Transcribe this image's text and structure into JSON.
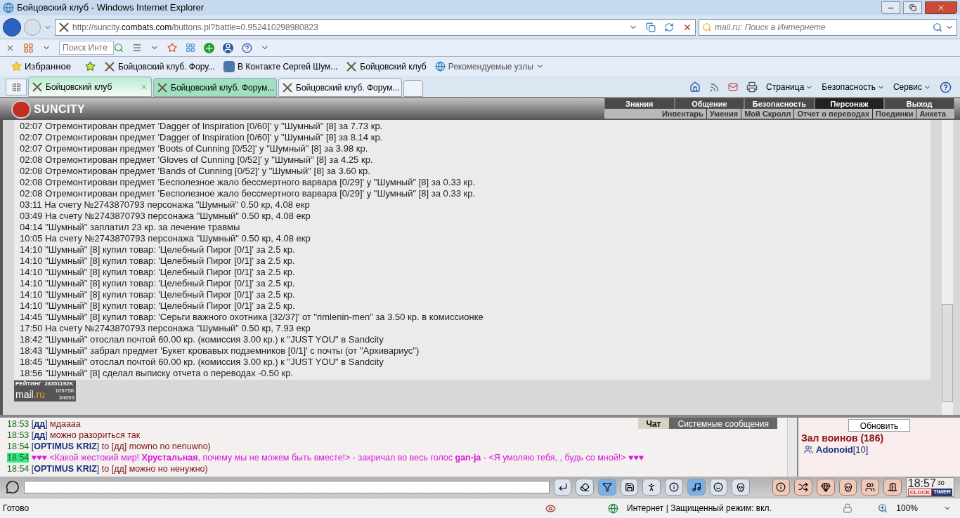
{
  "window": {
    "title": "Бойцовский клуб - Windows Internet Explorer"
  },
  "address": {
    "url_prefix": "http://suncity.",
    "url_domain": "combats.com",
    "url_rest": "/buttons.pl?battle=0.952410298980823"
  },
  "search": {
    "placeholder": "mail.ru: Поиск в Интернете"
  },
  "toolbar_search": {
    "placeholder": "Поиск Инте"
  },
  "favorites": {
    "label": "Избранное",
    "links": [
      {
        "label": "Бойцовский клуб. Фору...",
        "kind": "swords"
      },
      {
        "label": "В Контакте  Сергей Шум...",
        "kind": "vk"
      },
      {
        "label": "Бойцовский клуб",
        "kind": "swords"
      },
      {
        "label": "Рекомендуемые узлы",
        "kind": "ie"
      }
    ]
  },
  "tabs": [
    {
      "label": "Бойцовский клуб",
      "selected": true,
      "grouped": true
    },
    {
      "label": "Бойцовский клуб. Форум...",
      "selected": false,
      "grouped": true
    },
    {
      "label": "Бойцовский клуб. Форум...",
      "selected": false,
      "grouped": false
    }
  ],
  "command_bar": [
    "Страница",
    "Безопасность",
    "Сервис"
  ],
  "game": {
    "logo": "SUNCITY",
    "menu": [
      {
        "label": "Знания",
        "selected": false
      },
      {
        "label": "Общение",
        "selected": false
      },
      {
        "label": "Безопасность",
        "selected": false
      },
      {
        "label": "Персонаж",
        "selected": true
      },
      {
        "label": "Выход",
        "selected": false
      }
    ],
    "submenu": [
      "Инвентарь",
      "Умения",
      "Мой Скролл",
      "Отчет о переводах",
      "Поединки",
      "Анкета"
    ]
  },
  "log": [
    "02:07 Отремонтирован предмет 'Dagger of Inspiration [0/60]' у \"Шумный\" [8] за 7.73 кр.",
    "02:07 Отремонтирован предмет 'Dagger of Inspiration [0/60]' у \"Шумный\" [8] за 8.14 кр.",
    "02:07 Отремонтирован предмет 'Boots of Cunning [0/52]' у \"Шумный\" [8] за 3.98 кр.",
    "02:08 Отремонтирован предмет 'Gloves of Cunning [0/52]' у \"Шумный\" [8] за 4.25 кр.",
    "02:08 Отремонтирован предмет 'Bands of Cunning [0/52]' у \"Шумный\" [8] за 3.60 кр.",
    "02:08 Отремонтирован предмет 'Бесполезное жало бессмертного варвара [0/29]' у \"Шумный\" [8] за 0.33 кр.",
    "02:08 Отремонтирован предмет 'Бесполезное жало бессмертного варвара [0/29]' у \"Шумный\" [8] за 0.33 кр.",
    "03:11 На счету №2743870793 персонажа \"Шумный\" 0.50 кр, 4.08 екр",
    "03:49 На счету №2743870793 персонажа \"Шумный\" 0.50 кр, 4.08 екр",
    "04:14 \"Шумный\" заплатил 23 кр. за лечение травмы",
    "10:05 На счету №2743870793 персонажа \"Шумный\" 0.50 кр, 4.08 екр",
    "14:10 \"Шумный\" [8] купил товар: 'Целебный Пирог [0/1]' за 2.5 кр.",
    "14:10 \"Шумный\" [8] купил товар: 'Целебный Пирог [0/1]' за 2.5 кр.",
    "14:10 \"Шумный\" [8] купил товар: 'Целебный Пирог [0/1]' за 2.5 кр.",
    "14:10 \"Шумный\" [8] купил товар: 'Целебный Пирог [0/1]' за 2.5 кр.",
    "14:10 \"Шумный\" [8] купил товар: 'Целебный Пирог [0/1]' за 2.5 кр.",
    "14:10 \"Шумный\" [8] купил товар: 'Целебный Пирог [0/1]' за 2.5 кр.",
    "14:45 \"Шумный\" [8] купил товар: 'Серьги важного охотника [32/37]' от \"rimlenin-men\" за 3.50 кр. в комиссионке",
    "17:50 На счету №2743870793 персонажа \"Шумный\" 0.50 кр, 7.93 екр",
    "18:42 \"Шумный\" отослал почтой 60.00 кр. (комиссия 3.00 кр.) к \"JUST YOU\" в Sandcity",
    "18:43 \"Шумный\" забрал предмет 'Букет кровавых подземников [0/1]' с почты (от \"Архивариус\")",
    "18:45 \"Шумный\" отослал почтой 60.00 кр. (комиссия 3.00 кр.) к \"JUST YOU\" в Sandcity",
    "18:56 \"Шумный\" [8] сделал выписку отчета о переводах -0.50 кр."
  ],
  "rating_badge": {
    "title": "РЕЙТИНГ",
    "total": "28351192K",
    "brand_a": "mail",
    "brand_b": ".ru",
    "stat_1": "10975K",
    "stat_2": "34693"
  },
  "chat_tabs": [
    {
      "label": "Чат",
      "selected": true
    },
    {
      "label": "Системные сообщения",
      "selected": false
    }
  ],
  "chat": [
    {
      "time": "18:53",
      "highlight": false,
      "parts": [
        {
          "kind": "punct",
          "text": "["
        },
        {
          "kind": "nick",
          "text": "дд"
        },
        {
          "kind": "punct",
          "text": "]"
        },
        {
          "kind": "text",
          "text": " мдаааа"
        }
      ]
    },
    {
      "time": "18:53",
      "highlight": false,
      "parts": [
        {
          "kind": "punct",
          "text": "["
        },
        {
          "kind": "nick",
          "text": "дд"
        },
        {
          "kind": "punct",
          "text": "]"
        },
        {
          "kind": "text",
          "text": " можно разориться так"
        }
      ]
    },
    {
      "time": "18:54",
      "highlight": false,
      "parts": [
        {
          "kind": "punct",
          "text": "["
        },
        {
          "kind": "nick",
          "text": "OPTIMUS KRIZ"
        },
        {
          "kind": "punct",
          "text": "]"
        },
        {
          "kind": "text",
          "text": " to [дд] mowno no nenuwno)"
        }
      ]
    },
    {
      "time": "18:54",
      "highlight": true,
      "parts": [
        {
          "kind": "emote_bold",
          "text": "♥♥♥"
        },
        {
          "kind": "emote",
          "text": " <Какой жестокий мир! "
        },
        {
          "kind": "emote_bold",
          "text": "Хрустальная"
        },
        {
          "kind": "emote",
          "text": ", почему мы не можем быть вместе!> - закричал во весь голос "
        },
        {
          "kind": "emote_bold",
          "text": "gan-ja"
        },
        {
          "kind": "emote",
          "text": " - <Я умоляю тебя, , будь со мной!> "
        },
        {
          "kind": "emote_bold",
          "text": "♥♥♥"
        }
      ]
    },
    {
      "time": "18:54",
      "highlight": false,
      "parts": [
        {
          "kind": "punct",
          "text": "["
        },
        {
          "kind": "nick",
          "text": "OPTIMUS KRIZ"
        },
        {
          "kind": "punct",
          "text": "]"
        },
        {
          "kind": "text",
          "text": " to [дд] можно но ненужно)"
        }
      ]
    }
  ],
  "side_panel": {
    "refresh": "Обновить",
    "heading": "Зал воинов (186)",
    "user": "Adonoid",
    "level": "[10]"
  },
  "clock": {
    "time": "18:57",
    "seconds": "30",
    "clock_label": "CLOCK",
    "timer_label": "TIMER"
  },
  "status_bar": {
    "status": "Готово",
    "zone": "Интернет | Защищенный режим: вкл.",
    "zoom": "100%"
  }
}
